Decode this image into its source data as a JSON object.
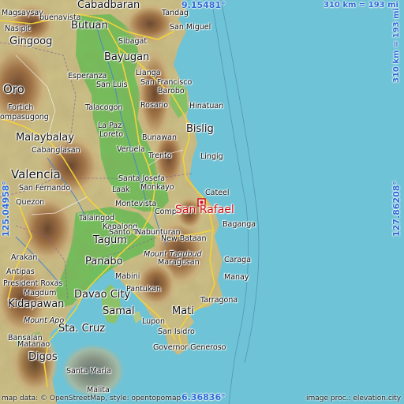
{
  "coordinates": {
    "lat_top": "9.15481°",
    "lat_bottom": "6.36836°",
    "lon_left": "125.04958°",
    "lon_right": "127.86208°"
  },
  "scale": {
    "top": "310 km = 193 mi",
    "right": "310 km = 193 mi"
  },
  "target": "San Rafael",
  "places": {
    "cabadbaran": "Cabadbaran",
    "magsaysay": "Magsaysay",
    "buenavista": "buenavista",
    "nasipit": "Nasipit",
    "butuan": "Butuan",
    "tandag": "Tandag",
    "san_miguel": "San Miguel",
    "gingoog": "Gingoog",
    "sibagat": "Sibagat",
    "bayugan": "Bayugan",
    "esperanza": "Esperanza",
    "lianga": "Lianga",
    "san_luis": "San Luis",
    "san_francisco": "San Francisco",
    "barobo": "Barobo",
    "oro": "Oro",
    "fortich": "Fortich",
    "ompasugong": "ompasugong",
    "talacogon": "Talacogon",
    "rosario": "Rosario",
    "hinatuan": "Hinatuan",
    "bislig": "Bislig",
    "malaybalay": "Malaybalay",
    "la_paz": "La Paz",
    "loreto": "Loreto",
    "cabanglasan": "Cabanglasan",
    "veruela": "Veruela",
    "bunawan": "Bunawan",
    "lingig": "Lingig",
    "trento": "Trento",
    "valencia": "Valencia",
    "santa_josefa": "Santa Josefa",
    "san_fernando": "San Fernando",
    "monkayo": "Monkayo",
    "laak": "Laak",
    "cateel": "Cateel",
    "quezon": "Quezon",
    "montevista": "Montevista",
    "compostela": "Compo",
    "baganga": "Baganga",
    "talaingod": "Talaingod",
    "kapalong": "Kapalong",
    "santo_tomas": "Santo Tomas",
    "nabunturan": "Nabunturan",
    "new_bataan": "New Bataan",
    "tagum": "Tagum",
    "mount_tagubud": "Mount Tagubud",
    "maragusan": "Maragusan",
    "caraga": "Caraga",
    "arakan": "Arakan",
    "panabo": "Panabo",
    "manay": "Manay",
    "antipas": "Antipas",
    "president_roxas": "President Roxas",
    "magdum": "Magdum",
    "kidapawan": "Kidapawan",
    "davao_city": "Davao City",
    "mabini": "Mabini",
    "pantukan": "Pantukan",
    "tarragona": "Tarragona",
    "mount_apo": "Mount Apo",
    "samal": "Samal",
    "mati": "Mati",
    "sta_cruz": "Sta. Cruz",
    "lupon": "Lupon",
    "bansalan": "Bansalan",
    "san_isidro": "San Isidro",
    "matanao": "Matanao",
    "governor_generoso": "Governor Generoso",
    "digos": "Digos",
    "santa_maria": "Santa Maria",
    "malita": "Malita"
  },
  "credits": {
    "left": "map data: © OpenStreetMap, style: opentopomap",
    "right": "image proc.: elevation.city"
  },
  "colors": {
    "sea": "#6fc3d6",
    "lowland": "#6fbf5a",
    "hills": "#d8c894",
    "mountains": "#9c6a3e",
    "peaks": "#5a3420",
    "coordinate_text": "#2a6bd6",
    "target_marker": "#cc1111"
  }
}
